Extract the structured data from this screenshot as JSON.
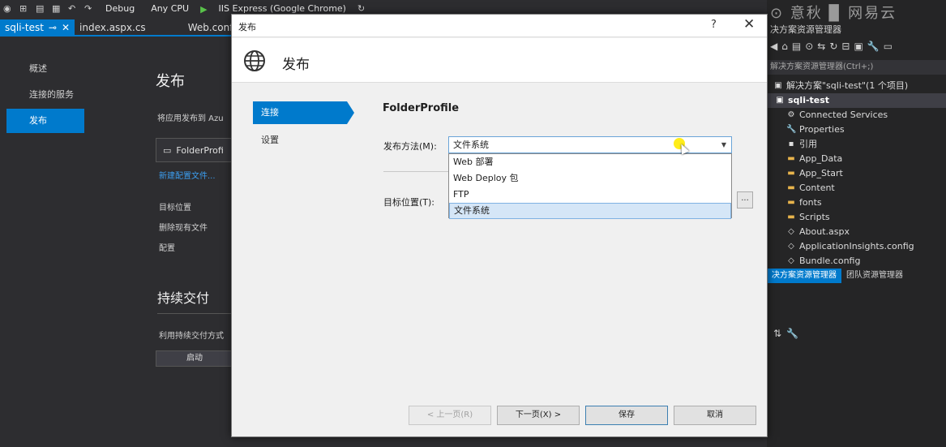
{
  "toolbar": {
    "config": "Debug",
    "platform": "Any CPU",
    "run_target": "IIS Express (Google Chrome)"
  },
  "tabs": [
    {
      "label": "sqli-test",
      "pin": "⊸",
      "close": "✕"
    },
    {
      "label": "index.aspx.cs"
    },
    {
      "label": "Web.config"
    }
  ],
  "leftnav": {
    "items": [
      "概述",
      "连接的服务",
      "发布"
    ]
  },
  "publish_page": {
    "title": "发布",
    "subtitle": "将应用发布到 Azu",
    "profile_box": "FolderProfi",
    "new_profile_link": "新建配置文件...",
    "rows": [
      "目标位置",
      "删除现有文件",
      "配置"
    ],
    "cd_title": "持续交付",
    "cd_desc": "利用持续交付方式",
    "start_button": "启动"
  },
  "solution_explorer": {
    "watermark": "⊙ 意秋  ▉ 网易云",
    "title": "决方案资源管理器",
    "search_placeholder": "解决方案资源管理器(Ctrl+;)",
    "tree": [
      {
        "label": "解决方案\"sqli-test\"(1 个项目)",
        "icon": "▣",
        "indent": 8
      },
      {
        "label": "sqli-test",
        "icon": "▣",
        "indent": 10,
        "selected": true
      },
      {
        "label": "Connected Services",
        "icon": "⚙",
        "indent": 24
      },
      {
        "label": "Properties",
        "icon": "🔧",
        "indent": 24
      },
      {
        "label": "引用",
        "icon": "▪",
        "indent": 24
      },
      {
        "label": "App_Data",
        "icon": "▬",
        "indent": 24,
        "folder": true
      },
      {
        "label": "App_Start",
        "icon": "▬",
        "indent": 24,
        "folder": true
      },
      {
        "label": "Content",
        "icon": "▬",
        "indent": 24,
        "folder": true
      },
      {
        "label": "fonts",
        "icon": "▬",
        "indent": 24,
        "folder": true
      },
      {
        "label": "Scripts",
        "icon": "▬",
        "indent": 24,
        "folder": true
      },
      {
        "label": "About.aspx",
        "icon": "◇",
        "indent": 24
      },
      {
        "label": "ApplicationInsights.config",
        "icon": "◇",
        "indent": 24
      },
      {
        "label": "Bundle.config",
        "icon": "◇",
        "indent": 24
      }
    ],
    "tabs": [
      "决方案资源管理器",
      "团队资源管理器"
    ]
  },
  "dialog": {
    "title": "发布",
    "help": "?",
    "close": "✕",
    "heading": "发布",
    "steps": [
      "连接",
      "设置"
    ],
    "profile_name": "FolderProfile",
    "method_label": "发布方法(M):",
    "method_value": "文件系统",
    "target_label": "目标位置(T):",
    "browse": "...",
    "options": [
      "Web 部署",
      "Web Deploy 包",
      "FTP",
      "文件系统"
    ],
    "selected_option_index": 3,
    "buttons": {
      "prev": "< 上一页(R)",
      "next": "下一页(X) >",
      "save": "保存",
      "cancel": "取消"
    }
  }
}
